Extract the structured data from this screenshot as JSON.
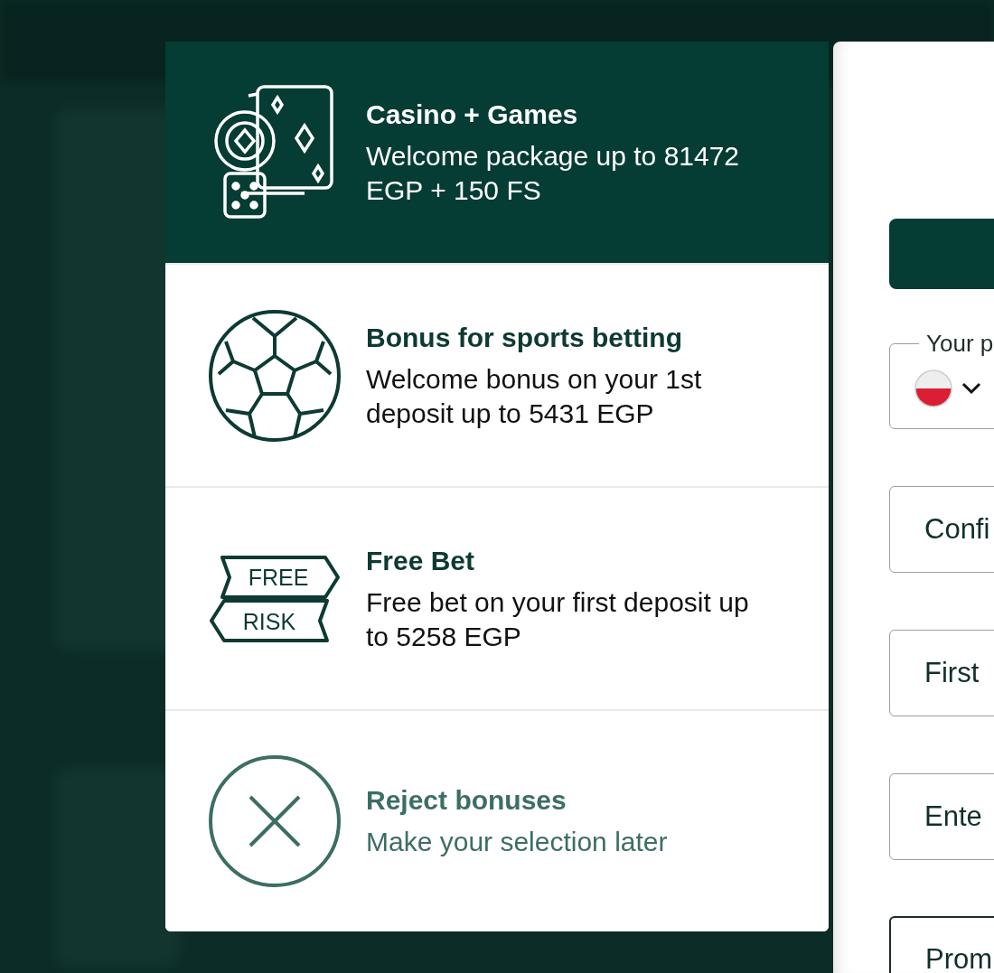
{
  "bonus_options": [
    {
      "kind": "casino",
      "title": "Casino + Games",
      "description": "Welcome package up to 81472 EGP + 150 FS",
      "selected": true
    },
    {
      "kind": "sports",
      "title": "Bonus for sports betting",
      "description": "Welcome bonus on your 1st deposit up to 5431 EGP",
      "selected": false
    },
    {
      "kind": "freebet",
      "title": "Free Bet",
      "description": "Free bet on your first deposit up to 5258 EGP",
      "selected": false,
      "icon_labels": [
        "FREE",
        "RISK"
      ]
    },
    {
      "kind": "reject",
      "title": "Reject bonuses",
      "description": "Make your selection later",
      "selected": false
    }
  ],
  "registration_form": {
    "fields": [
      {
        "kind": "phone",
        "label": "Your p"
      },
      {
        "kind": "text",
        "placeholder": "Confi"
      },
      {
        "kind": "text",
        "placeholder": "First"
      },
      {
        "kind": "text",
        "placeholder": "Ente"
      },
      {
        "kind": "promo",
        "placeholder": "Prom"
      }
    ]
  }
}
